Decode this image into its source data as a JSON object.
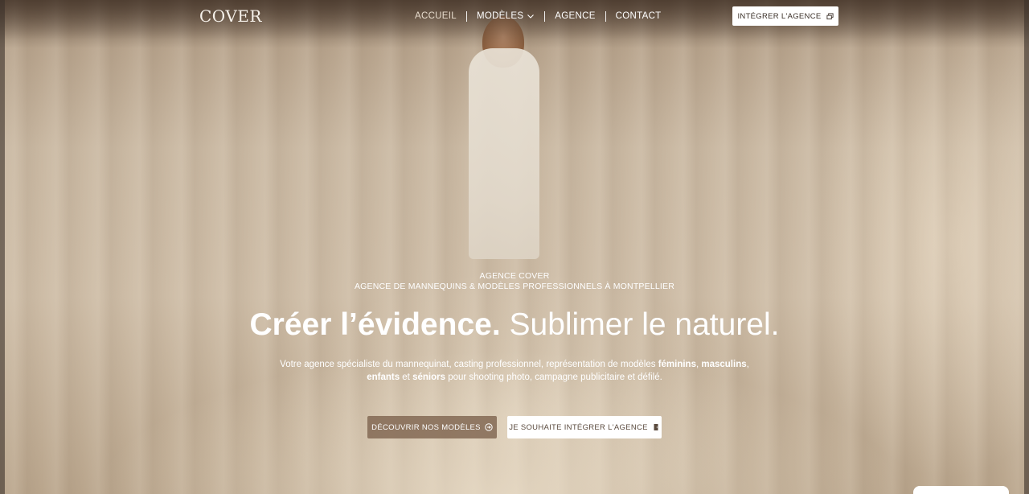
{
  "header": {
    "logo": "COVER",
    "nav": {
      "home": "ACCUEIL",
      "models": "MODÈLES",
      "agency": "AGENCE",
      "contact": "CONTACT"
    },
    "cta": "INTÉGRER L'AGENCE"
  },
  "hero": {
    "kicker_line1": "AGENCE COVER",
    "kicker_line2": "AGENCE DE MANNEQUINS & MODÈLES PROFESSIONNELS À MONTPELLIER",
    "headline_bold": "Créer l’évidence.",
    "headline_light": "Sublimer le naturel.",
    "lede": {
      "part1": "Votre agence spécialiste du mannequinat, casting professionnel, représentation de modèles ",
      "bold1": "féminins",
      "sep1": ", ",
      "bold2": "masculins",
      "sep2": ",",
      "bold3": "enfants",
      "part2": " et ",
      "bold4": "séniors",
      "part3": " pour shooting photo, campagne publicitaire et défilé."
    },
    "primary_button": "DÉCOUVRIR NOS MODÈLES",
    "secondary_button": "JE SOUHAITE INTÉGRER L'AGENCE"
  },
  "colors": {
    "primary_button_bg": "#826854",
    "text_light": "#ffffff",
    "button_text_dark": "#3a2f27"
  },
  "icons": {
    "models_chevron": "chevron-down-icon",
    "cta_external": "external-window-icon",
    "primary_arrow": "arrow-circle-right-icon",
    "secondary_door": "door-icon"
  }
}
